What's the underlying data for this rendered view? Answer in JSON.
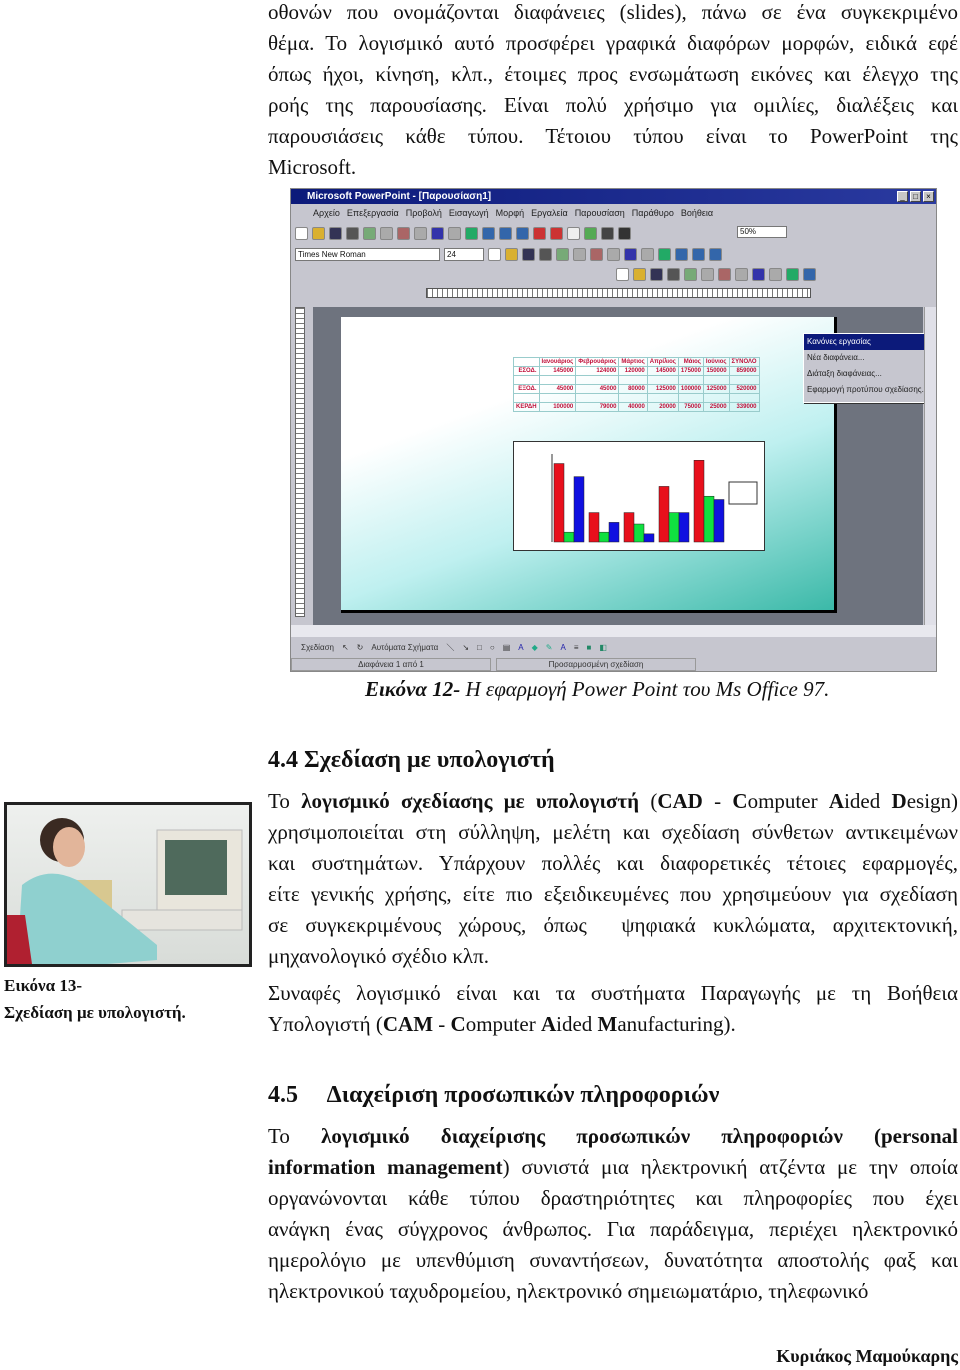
{
  "intro": {
    "lines": [
      [
        {
          "t": "οθονών που ονομάζονται διαφάνειες (slides), πάνω σε ένα συγκεκριμένο"
        }
      ],
      [
        {
          "t": "θέμα. Το λογισμικό αυτό προσφέρει γραφικά διαφόρων μορφών, ειδικά εφέ"
        }
      ],
      [
        {
          "t": "όπως ήχοι, κίνηση, κλπ., έτοιμες προς ενσωμάτωση εικόνες και έλεγχο της"
        }
      ],
      [
        {
          "t": "ροής της παρουσίασης. Είναι πολύ χρήσιμο για ομιλίες, διαλέξεις και"
        }
      ],
      [
        {
          "t": "παρουσιάσεις κάθε τύπου. Τέτοιου τύπου είναι το PowerPoint της"
        }
      ],
      [
        {
          "t": "Microsoft."
        }
      ]
    ]
  },
  "ppt": {
    "title": "Microsoft PowerPoint - [Παρουσίαση1]",
    "menu": [
      "Αρχείο",
      "Επεξεργασία",
      "Προβολή",
      "Εισαγωγή",
      "Μορφή",
      "Εργαλεία",
      "Παρουσίαση",
      "Παράθυρο",
      "Βοήθεια"
    ],
    "font_name": "Times New Roman",
    "font_size": "24",
    "zoom": "50%",
    "popup": [
      "Κανόνες εργασίας",
      "Νέα διαφάνεια...",
      "Διάταξη διαφάνειας...",
      "Εφαρμογή προτύπου σχεδίασης..."
    ],
    "draw_label": "Σχεδίαση",
    "autoshapes_label": "Αυτόματα Σχήματα",
    "status_slide": "Διαφάνεια 1 από 1",
    "status_template": "Προσαρμοσμένη σχεδίαση",
    "table": {
      "headers": [
        "",
        "Ιανουάριος",
        "Φεβρουάριος",
        "Μάρτιος",
        "Απρίλιος",
        "Μάιος",
        "Ιούνιος",
        "ΣΥΝΟΛΟ"
      ],
      "rows": [
        [
          "ΕΣΟΔ.",
          "145000",
          "124000",
          "120000",
          "145000",
          "175000",
          "150000",
          "859000"
        ],
        [
          "ΕΞΟΔ.",
          "45000",
          "45000",
          "80000",
          "125000",
          "100000",
          "125000",
          "520000"
        ],
        [
          "ΚΕΡΔΗ",
          "100000",
          "79000",
          "40000",
          "20000",
          "75000",
          "25000",
          "339000"
        ]
      ]
    },
    "chart": {
      "type": "bar",
      "colors": [
        "#e8101c",
        "#10e040",
        "#1010e0"
      ],
      "groups": [
        [
          240,
          30,
          200
        ],
        [
          90,
          30,
          60
        ],
        [
          90,
          55,
          25
        ],
        [
          170,
          90,
          90
        ],
        [
          250,
          140,
          130
        ]
      ]
    }
  },
  "figure12": {
    "label": "Εικόνα 12-",
    "text": " Η εφαρμογή Power Point του Ms Office 97."
  },
  "section44": {
    "title": "4.4  Σχεδίαση με υπολογιστή",
    "lines": [
      [
        {
          "t": "Το "
        },
        {
          "t": "λογισμικό σχεδίασης με υπολογιστή",
          "b": 1
        },
        {
          "t": " ("
        },
        {
          "t": "CAD",
          "b": 1
        },
        {
          "t": " - "
        },
        {
          "t": "C",
          "b": 1
        },
        {
          "t": "omputer "
        },
        {
          "t": "A",
          "b": 1
        },
        {
          "t": "ided "
        },
        {
          "t": "D",
          "b": 1
        },
        {
          "t": "esign)"
        }
      ],
      [
        {
          "t": "χρησιμοποιείται στη σύλληψη, μελέτη και σχεδίαση σύνθετων αντικειμένων"
        }
      ],
      [
        {
          "t": "και συστημάτων. Υπάρχουν πολλές και διαφορετικές τέτοιες εφαρμογές,"
        }
      ],
      [
        {
          "t": "είτε γενικής χρήσης, είτε πιο εξειδικευμένες που χρησιμεύουν για σχεδίαση"
        }
      ],
      [
        {
          "t": "σε συγκεκριμένους χώρους, όπως  ψηφιακά κυκλώματα, αρχιτεκτονική,"
        }
      ],
      [
        {
          "t": "μηχανολογικό σχέδιο κλπ."
        }
      ]
    ],
    "lines2": [
      [
        {
          "t": "Συναφές λογισμικό είναι και τα συστήματα Παραγωγής με τη Βοήθεια"
        }
      ],
      [
        {
          "t": "Υπολογιστή ("
        },
        {
          "t": "CAM",
          "b": 1
        },
        {
          "t": " - "
        },
        {
          "t": "C",
          "b": 1
        },
        {
          "t": "omputer "
        },
        {
          "t": "A",
          "b": 1
        },
        {
          "t": "ided "
        },
        {
          "t": "M",
          "b": 1
        },
        {
          "t": "anufacturing)."
        }
      ]
    ]
  },
  "figure13": {
    "label": "Εικόνα 13-",
    "text": "Σχεδίαση με υπολογιστή."
  },
  "section45": {
    "title": "4.5     Διαχείριση προσωπικών πληροφοριών",
    "lines": [
      [
        {
          "t": "Το "
        },
        {
          "t": "λογισμικό διαχείρισης προσωπικών πληροφοριών (personal",
          "b": 1
        }
      ],
      [
        {
          "t": "information management",
          "b": 1
        },
        {
          "t": ") συνιστά μια ηλεκτρονική ατζέντα με την οποία"
        }
      ],
      [
        {
          "t": "οργανώνονται κάθε τύπου δραστηριότητες και πληροφορίες που έχει"
        }
      ],
      [
        {
          "t": "ανάγκη ένας σύγχρονος άνθρωπος. Για παράδειγμα, περιέχει ηλεκτρονικό"
        }
      ],
      [
        {
          "t": "ημερολόγιο με υπενθύμιση συναντήσεων, δυνατότητα αποστολής φαξ και"
        }
      ],
      [
        {
          "t": "ηλεκτρονικού ταχυδρομείου, ηλεκτρονικό σημειωματάριο, τηλεφωνικό"
        }
      ]
    ]
  },
  "footer": {
    "author": "Κυριάκος Μαμούκαρης"
  }
}
